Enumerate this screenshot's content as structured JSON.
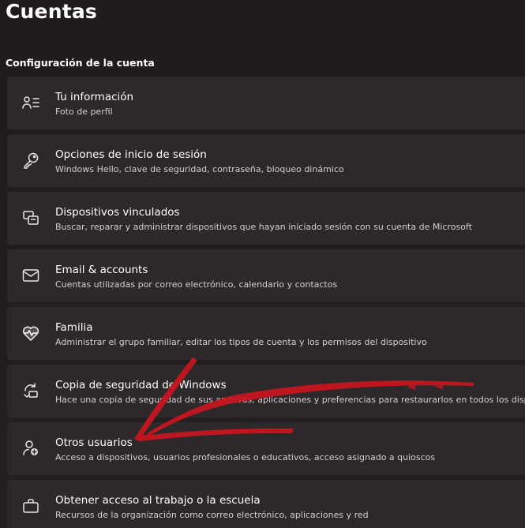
{
  "page": {
    "title": "Cuentas",
    "section_title": "Configuración de la cuenta"
  },
  "items": [
    {
      "title": "Tu información",
      "subtitle": "Foto de perfil",
      "icon": "person-list-icon"
    },
    {
      "title": "Opciones de inicio de sesión",
      "subtitle": "Windows Hello, clave de seguridad, contraseña, bloqueo dinámico",
      "icon": "key-icon"
    },
    {
      "title": "Dispositivos vinculados",
      "subtitle": "Buscar, reparar y administrar dispositivos que hayan iniciado sesión con su cuenta de Microsoft",
      "icon": "linked-devices-icon"
    },
    {
      "title": "Email & accounts",
      "subtitle": "Cuentas utilizadas por correo electrónico, calendario y contactos",
      "icon": "mail-icon"
    },
    {
      "title": "Familia",
      "subtitle": "Administrar el grupo familiar, editar los tipos de cuenta y los permisos del dispositivo",
      "icon": "family-heart-icon"
    },
    {
      "title": "Copia de seguridad de Windows",
      "subtitle": "Hace una copia de seguridad de sus archivos, aplicaciones y preferencias para restaurarlos en todos los dispositivos",
      "icon": "backup-icon"
    },
    {
      "title": "Otros usuarios",
      "subtitle": "Acceso a dispositivos, usuarios profesionales o educativos, acceso asignado a quioscos",
      "icon": "add-user-icon"
    },
    {
      "title": "Obtener acceso al trabajo o la escuela",
      "subtitle": "Recursos de la organización como correo electrónico, aplicaciones y red",
      "icon": "briefcase-icon"
    }
  ],
  "colors": {
    "background": "#221d1f",
    "card": "#2d292b",
    "annotation_arrow": "#c8141e"
  }
}
